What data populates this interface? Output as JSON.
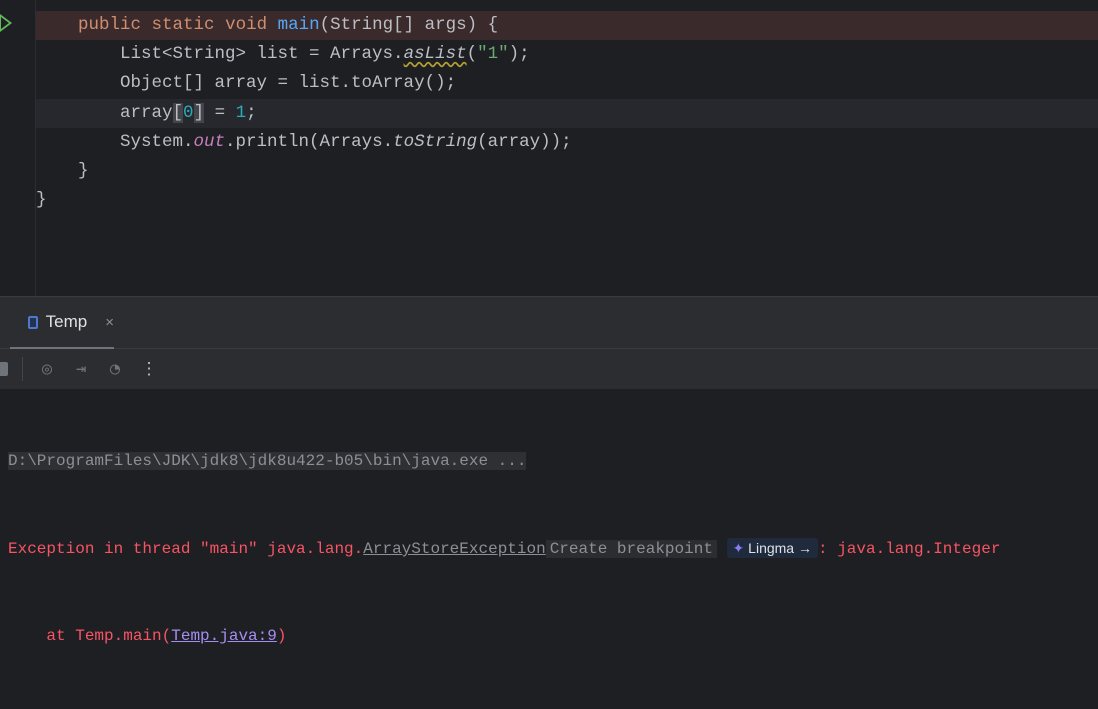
{
  "editor": {
    "lines": [
      [
        "public",
        " ",
        "static",
        " ",
        "void",
        " ",
        "main",
        "(String[] args) {"
      ],
      [
        "List<String> list = Arrays.",
        "asList",
        "(",
        "\"1\"",
        ");"
      ],
      [
        "Object[] array = list.toArray();"
      ],
      [
        "array",
        "[",
        "0",
        "]",
        " = ",
        "1",
        ";"
      ],
      [
        "System.",
        "out",
        ".println(Arrays.",
        "toString",
        "(array));"
      ],
      [
        "}"
      ],
      [
        "}"
      ]
    ]
  },
  "panel": {
    "tab_label": "Temp",
    "tab_close": "×",
    "more_icon": "⋮"
  },
  "console": {
    "command": "D:\\ProgramFiles\\JDK\\jdk8\\jdk8u422-b05\\bin\\java.exe ...",
    "exception_prefix": "Exception in thread \"main\" java.lang.",
    "exception_class": "ArrayStoreException",
    "create_breakpoint": "Create breakpoint",
    "lingma_label": "Lingma",
    "lingma_arrow": "→",
    "exception_suffix": ": java.lang.Integer",
    "at_prefix": "    at Temp.main(",
    "at_link": "Temp.java:9",
    "at_suffix": ")"
  }
}
